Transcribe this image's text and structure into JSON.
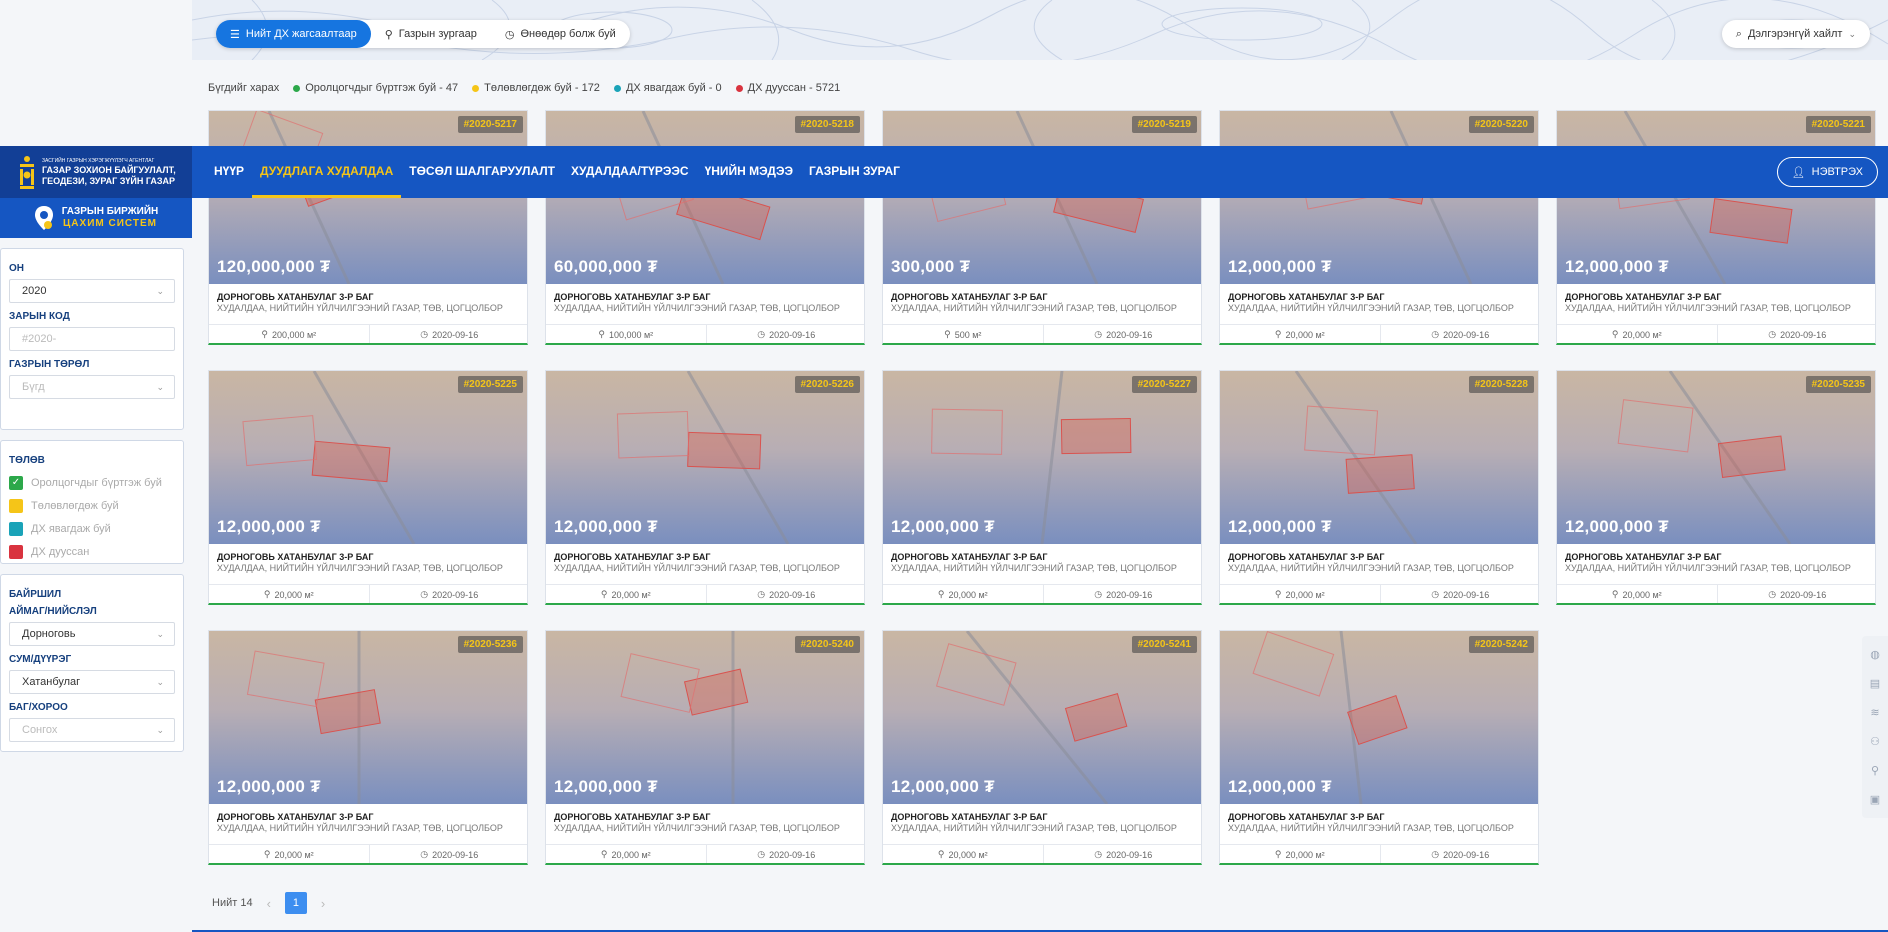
{
  "filter_tabs": [
    {
      "label": "Нийт ДХ жагсаалтаар",
      "icon": "list-icon",
      "active": true
    },
    {
      "label": "Газрын зургаар",
      "icon": "map-pin-icon",
      "active": false
    },
    {
      "label": "Өнөөдөр болж буй",
      "icon": "clock-icon",
      "active": false
    }
  ],
  "advanced_search": "Дэлгэрэнгүй хайлт",
  "legend": {
    "view_all": "Бүгдийг харах",
    "items": [
      {
        "label": "Оролцогчдыг бүртгэж буй - 47",
        "color": "#2ca84a"
      },
      {
        "label": "Төлөвлөгдөж буй - 172",
        "color": "#f5c518"
      },
      {
        "label": "ДХ явагдаж буй - 0",
        "color": "#1aa3b8"
      },
      {
        "label": "ДХ дууссан - 5721",
        "color": "#d9333f"
      }
    ]
  },
  "header": {
    "logo_small": "ЗАСГИЙН ГАЗРЫН ХЭРЭГЖҮҮЛЭГЧ АГЕНТЛАГ",
    "logo_line1": "ГАЗАР ЗОХИОН БАЙГУУЛАЛТ,",
    "logo_line2": "ГЕОДЕЗИ, ЗУРАГ ЗҮЙН ГАЗАР",
    "nav": [
      {
        "label": "НҮҮР",
        "active": false
      },
      {
        "label": "ДУУДЛАГА ХУДАЛДАА",
        "active": true
      },
      {
        "label": "ТӨСӨЛ ШАЛГАРУУЛАЛТ",
        "active": false
      },
      {
        "label": "ХУДАЛДАА/ТҮРЭЭС",
        "active": false
      },
      {
        "label": "ҮНИЙН МЭДЭЭ",
        "active": false
      },
      {
        "label": "ГАЗРЫН ЗУРАГ",
        "active": false
      }
    ],
    "login": "НЭВТРЭХ"
  },
  "sidebar": {
    "brand_line1": "ГАЗРЫН БИРЖИЙН",
    "brand_line2": "ЦАХИМ СИСТЕМ",
    "year_label": "ОН",
    "year_value": "2020",
    "code_label": "ЗАРЫН КОД",
    "code_placeholder": "#2020-",
    "type_label": "ГАЗРЫН ТӨРӨЛ",
    "type_value": "Бүгд",
    "status_label": "ТӨЛӨВ",
    "statuses": [
      {
        "label": "Оролцогчдыг бүртгэж буй",
        "color": "#2ca84a",
        "checked": true
      },
      {
        "label": "Төлөвлөгдөж буй",
        "color": "#f5c518",
        "checked": false
      },
      {
        "label": "ДХ явагдаж буй",
        "color": "#1aa3b8",
        "checked": false
      },
      {
        "label": "ДХ дууссан",
        "color": "#d9333f",
        "checked": false
      }
    ],
    "location_label": "БАЙРШИЛ",
    "aimag_label": "АЙМАГ/НИЙСЛЭЛ",
    "aimag_value": "Дорноговь",
    "sum_label": "СУМ/ДҮҮРЭГ",
    "sum_value": "Хатанбулаг",
    "bag_label": "БАГ/ХОРОО",
    "bag_value": "Сонгох"
  },
  "cards": [
    {
      "code": "#2020-5217",
      "price": "120,000,000 ₮",
      "title": "ДОРНОГОВЬ ХАТАНБУЛАГ 3-Р БАГ",
      "subtitle": "ХУДАЛДАА, НИЙТИЙН ҮЙЛЧИЛГЭЭНИЙ ГАЗАР, ТӨВ, ЦОГЦОЛБОР",
      "area": "200,000 м²",
      "date": "2020-09-16"
    },
    {
      "code": "#2020-5218",
      "price": "60,000,000 ₮",
      "title": "ДОРНОГОВЬ ХАТАНБУЛАГ 3-Р БАГ",
      "subtitle": "ХУДАЛДАА, НИЙТИЙН ҮЙЛЧИЛГЭЭНИЙ ГАЗАР, ТӨВ, ЦОГЦОЛБОР",
      "area": "100,000 м²",
      "date": "2020-09-16"
    },
    {
      "code": "#2020-5219",
      "price": "300,000 ₮",
      "title": "ДОРНОГОВЬ ХАТАНБУЛАГ 3-Р БАГ",
      "subtitle": "ХУДАЛДАА, НИЙТИЙН ҮЙЛЧИЛГЭЭНИЙ ГАЗАР, ТӨВ, ЦОГЦОЛБОР",
      "area": "500 м²",
      "date": "2020-09-16"
    },
    {
      "code": "#2020-5220",
      "price": "12,000,000 ₮",
      "title": "ДОРНОГОВЬ ХАТАНБУЛАГ 3-Р БАГ",
      "subtitle": "ХУДАЛДАА, НИЙТИЙН ҮЙЛЧИЛГЭЭНИЙ ГАЗАР, ТӨВ, ЦОГЦОЛБОР",
      "area": "20,000 м²",
      "date": "2020-09-16"
    },
    {
      "code": "#2020-5221",
      "price": "12,000,000 ₮",
      "title": "ДОРНОГОВЬ ХАТАНБУЛАГ 3-Р БАГ",
      "subtitle": "ХУДАЛДАА, НИЙТИЙН ҮЙЛЧИЛГЭЭНИЙ ГАЗАР, ТӨВ, ЦОГЦОЛБОР",
      "area": "20,000 м²",
      "date": "2020-09-16"
    },
    {
      "code": "#2020-5225",
      "price": "12,000,000 ₮",
      "title": "ДОРНОГОВЬ ХАТАНБУЛАГ 3-Р БАГ",
      "subtitle": "ХУДАЛДАА, НИЙТИЙН ҮЙЛЧИЛГЭЭНИЙ ГАЗАР, ТӨВ, ЦОГЦОЛБОР",
      "area": "20,000 м²",
      "date": "2020-09-16"
    },
    {
      "code": "#2020-5226",
      "price": "12,000,000 ₮",
      "title": "ДОРНОГОВЬ ХАТАНБУЛАГ 3-Р БАГ",
      "subtitle": "ХУДАЛДАА, НИЙТИЙН ҮЙЛЧИЛГЭЭНИЙ ГАЗАР, ТӨВ, ЦОГЦОЛБОР",
      "area": "20,000 м²",
      "date": "2020-09-16"
    },
    {
      "code": "#2020-5227",
      "price": "12,000,000 ₮",
      "title": "ДОРНОГОВЬ ХАТАНБУЛАГ 3-Р БАГ",
      "subtitle": "ХУДАЛДАА, НИЙТИЙН ҮЙЛЧИЛГЭЭНИЙ ГАЗАР, ТӨВ, ЦОГЦОЛБОР",
      "area": "20,000 м²",
      "date": "2020-09-16"
    },
    {
      "code": "#2020-5228",
      "price": "12,000,000 ₮",
      "title": "ДОРНОГОВЬ ХАТАНБУЛАГ 3-Р БАГ",
      "subtitle": "ХУДАЛДАА, НИЙТИЙН ҮЙЛЧИЛГЭЭНИЙ ГАЗАР, ТӨВ, ЦОГЦОЛБОР",
      "area": "20,000 м²",
      "date": "2020-09-16"
    },
    {
      "code": "#2020-5235",
      "price": "12,000,000 ₮",
      "title": "ДОРНОГОВЬ ХАТАНБУЛАГ 3-Р БАГ",
      "subtitle": "ХУДАЛДАА, НИЙТИЙН ҮЙЛЧИЛГЭЭНИЙ ГАЗАР, ТӨВ, ЦОГЦОЛБОР",
      "area": "20,000 м²",
      "date": "2020-09-16"
    },
    {
      "code": "#2020-5236",
      "price": "12,000,000 ₮",
      "title": "ДОРНОГОВЬ ХАТАНБУЛАГ 3-Р БАГ",
      "subtitle": "ХУДАЛДАА, НИЙТИЙН ҮЙЛЧИЛГЭЭНИЙ ГАЗАР, ТӨВ, ЦОГЦОЛБОР",
      "area": "20,000 м²",
      "date": "2020-09-16"
    },
    {
      "code": "#2020-5240",
      "price": "12,000,000 ₮",
      "title": "ДОРНОГОВЬ ХАТАНБУЛАГ 3-Р БАГ",
      "subtitle": "ХУДАЛДАА, НИЙТИЙН ҮЙЛЧИЛГЭЭНИЙ ГАЗАР, ТӨВ, ЦОГЦОЛБОР",
      "area": "20,000 м²",
      "date": "2020-09-16"
    },
    {
      "code": "#2020-5241",
      "price": "12,000,000 ₮",
      "title": "ДОРНОГОВЬ ХАТАНБУЛАГ 3-Р БАГ",
      "subtitle": "ХУДАЛДАА, НИЙТИЙН ҮЙЛЧИЛГЭЭНИЙ ГАЗАР, ТӨВ, ЦОГЦОЛБОР",
      "area": "20,000 м²",
      "date": "2020-09-16"
    },
    {
      "code": "#2020-5242",
      "price": "12,000,000 ₮",
      "title": "ДОРНОГОВЬ ХАТАНБУЛАГ 3-Р БАГ",
      "subtitle": "ХУДАЛДАА, НИЙТИЙН ҮЙЛЧИЛГЭЭНИЙ ГАЗАР, ТӨВ, ЦОГЦОЛБОР",
      "area": "20,000 м²",
      "date": "2020-09-16"
    }
  ],
  "pagination": {
    "total": "Нийт 14",
    "current": "1"
  },
  "right_tools": [
    "globe-icon",
    "layers-icon",
    "stack-icon",
    "user-icon",
    "pin-icon",
    "save-icon"
  ],
  "colors": {
    "primary": "#1556c2",
    "accent": "#f5c518",
    "active_tab": "#1675e0",
    "status_green": "#2ca84a"
  }
}
